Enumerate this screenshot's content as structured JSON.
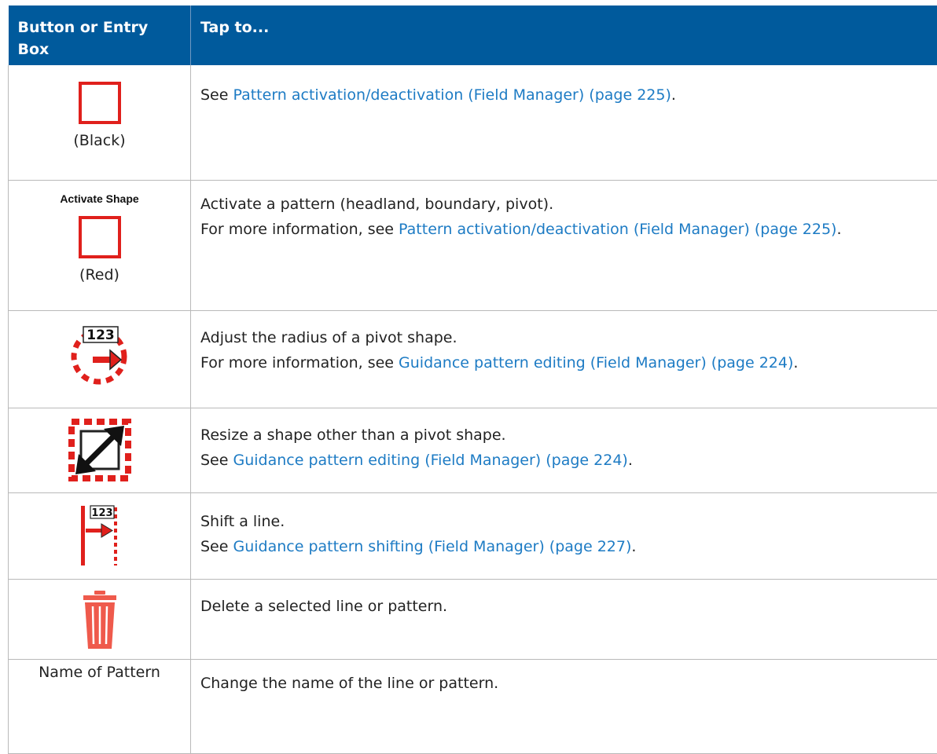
{
  "table": {
    "headers": [
      "Button or Entry Box",
      "Tap to..."
    ],
    "rows": [
      {
        "icon": "black-square-outline-icon",
        "caption": "(Black)",
        "lines": [
          {
            "pre": "See ",
            "link": "Pattern activation/deactivation (Field Manager) (page 225)",
            "post": "."
          }
        ]
      },
      {
        "icon": "red-square-outline-icon",
        "shape_label": "Activate Shape",
        "caption": "(Red)",
        "lines": [
          {
            "pre": "Activate a pattern (headland, boundary, pivot).",
            "link": "",
            "post": ""
          },
          {
            "pre": "For more information, see ",
            "link": "Pattern activation/deactivation (Field Manager) (page 225)",
            "post": "."
          }
        ]
      },
      {
        "icon": "pivot-radius-icon",
        "icon_text": "123",
        "lines": [
          {
            "pre": "Adjust the radius of a pivot shape.",
            "link": "",
            "post": ""
          },
          {
            "pre": "For more information, see ",
            "link": "Guidance pattern editing (Field Manager) (page 224)",
            "post": "."
          }
        ]
      },
      {
        "icon": "resize-shape-icon",
        "lines": [
          {
            "pre": "Resize a shape other than a pivot shape.",
            "link": "",
            "post": ""
          },
          {
            "pre": "See ",
            "link": "Guidance pattern editing (Field Manager) (page 224)",
            "post": "."
          }
        ]
      },
      {
        "icon": "shift-line-icon",
        "icon_text": "123",
        "lines": [
          {
            "pre": "Shift a line.",
            "link": "",
            "post": ""
          },
          {
            "pre": "See ",
            "link": "Guidance pattern shifting (Field Manager) (page 227)",
            "post": "."
          }
        ]
      },
      {
        "icon": "trash-icon",
        "lines": [
          {
            "pre": "Delete a selected line or pattern.",
            "link": "",
            "post": ""
          }
        ]
      },
      {
        "icon_label": "Name of Pattern",
        "lines": [
          {
            "pre": "Change the name of the line or pattern.",
            "link": "",
            "post": ""
          }
        ]
      }
    ]
  },
  "colors": {
    "header_bg": "#005a9c",
    "link": "#1d7bc4",
    "icon_red": "#e0201c",
    "trash_red": "#ef5a4c"
  }
}
